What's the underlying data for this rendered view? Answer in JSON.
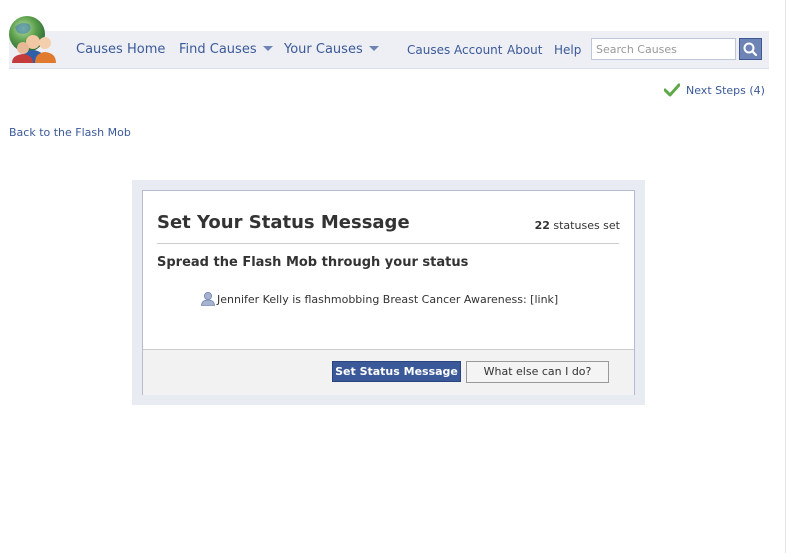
{
  "nav": {
    "items": [
      {
        "label": "Causes Home",
        "dropdown": false
      },
      {
        "label": "Find Causes",
        "dropdown": true
      },
      {
        "label": "Your Causes",
        "dropdown": true
      },
      {
        "label": "Causes Account",
        "dropdown": false
      },
      {
        "label": "About",
        "dropdown": false
      },
      {
        "label": "Help",
        "dropdown": false
      }
    ],
    "search": {
      "placeholder": "Search Causes",
      "value": ""
    },
    "icons": {
      "logo": "causes-globe-people-logo",
      "search": "magnifier-icon"
    }
  },
  "next_steps": {
    "label": "Next Steps (4)",
    "icon": "green-check-icon"
  },
  "back_link": {
    "label": "Back to the Flash Mob"
  },
  "dialog": {
    "title": "Set Your Status Message",
    "count_number": "22",
    "count_suffix": " statuses set",
    "subtitle": "Spread the Flash Mob through your status",
    "status_text": "Jennifer Kelly is flashmobbing Breast Cancer Awareness: [link]",
    "status_icon": "user-silhouette-icon",
    "primary_button": "Set Status Message",
    "secondary_button": "What else can I do?"
  },
  "colors": {
    "link": "#3b5998",
    "nav_background": "#edeff4",
    "button_primary": "#3b5998",
    "check_green": "#5fa84a"
  }
}
